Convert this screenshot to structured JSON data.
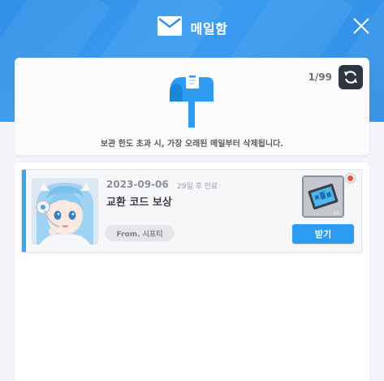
{
  "header": {
    "title": "메일함",
    "icon": "mail-envelope-icon",
    "close_icon": "close-icon"
  },
  "mailbox": {
    "counter": "1/99",
    "refresh_icon": "refresh-icon",
    "notice": "보관 한도 초과 시, 가장 오래된 메일부터 삭제됩니다."
  },
  "mails": [
    {
      "date": "2023-09-06",
      "expire": "29일 후 만료",
      "subject": "교환 코드 보상",
      "sender": "From. 시프티",
      "receive_label": "받기",
      "avatar_icon": "character-avatar-icon",
      "reward_icon": "reward-item-icon",
      "unread": true
    }
  ],
  "colors": {
    "header_blue": "#2f8fe6",
    "accent_blue": "#35a7ef",
    "button_blue": "#2b9cf0",
    "new_dot": "#e9513b"
  }
}
